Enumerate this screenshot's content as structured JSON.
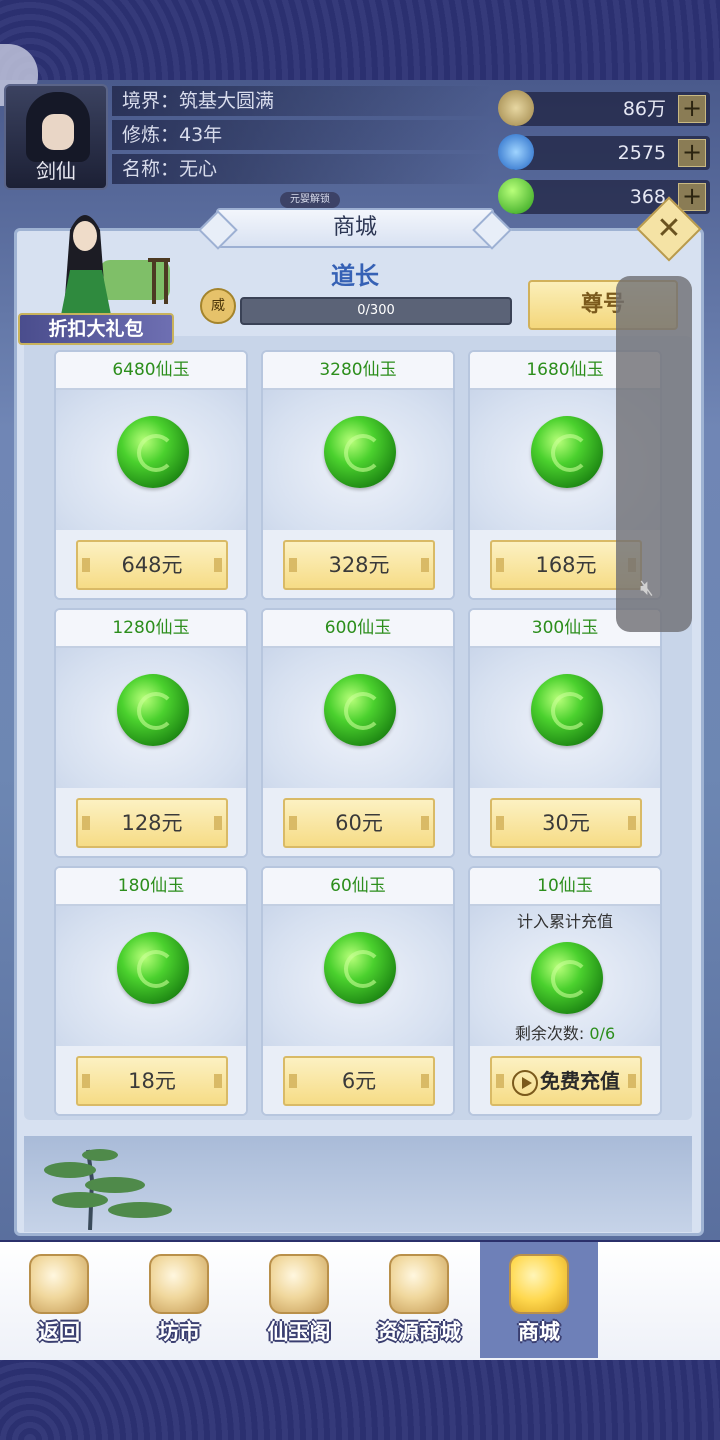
{
  "profile": {
    "avatar_label": "剑仙",
    "realm": "境界：筑基大圆满",
    "cultivation": "修炼：43年",
    "name": "名称：无心"
  },
  "resources": [
    {
      "value": "86万",
      "icon": "coin-icon"
    },
    {
      "value": "2575",
      "icon": "gem-icon"
    },
    {
      "value": "368",
      "icon": "jade-icon"
    }
  ],
  "unlock_tag": "元婴解锁",
  "shop": {
    "title": "商城",
    "gift_pack_label": "折扣大礼包",
    "rank_title": "道长",
    "rank_badge": "威",
    "progress_text": "0/300",
    "progress_fraction": 0,
    "vip_label": "尊号"
  },
  "products": [
    {
      "amount": "6480仙玉",
      "price": "648元"
    },
    {
      "amount": "3280仙玉",
      "price": "328元"
    },
    {
      "amount": "1680仙玉",
      "price": "168元"
    },
    {
      "amount": "1280仙玉",
      "price": "128元"
    },
    {
      "amount": "600仙玉",
      "price": "60元"
    },
    {
      "amount": "300仙玉",
      "price": "30元"
    },
    {
      "amount": "180仙玉",
      "price": "18元"
    },
    {
      "amount": "60仙玉",
      "price": "6元"
    },
    {
      "amount": "10仙玉",
      "note_top": "计入累计充值",
      "note_bottom_label": "剩余次数:",
      "note_bottom_count": "0/6",
      "price": "免费充值"
    }
  ],
  "nav": [
    {
      "label": "返回",
      "icon": "return-icon",
      "active": false
    },
    {
      "label": "坊市",
      "icon": "market-icon",
      "active": false
    },
    {
      "label": "仙玉阁",
      "icon": "jade-pavilion-icon",
      "active": false
    },
    {
      "label": "资源商城",
      "icon": "resource-shop-icon",
      "active": false
    },
    {
      "label": "商城",
      "icon": "shop-icon",
      "active": true
    }
  ]
}
